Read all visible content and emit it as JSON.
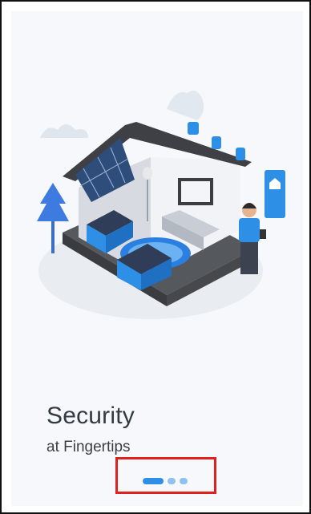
{
  "onboarding": {
    "title": "Security",
    "subtitle": "at Fingertips",
    "illustration_icon": "smart-home-illustration",
    "pager": {
      "total_pages": 3,
      "active_page": 1
    },
    "colors": {
      "accent": "#2d8fe5",
      "accent_light": "#8ec2f2",
      "highlight": "#e0201a"
    }
  }
}
